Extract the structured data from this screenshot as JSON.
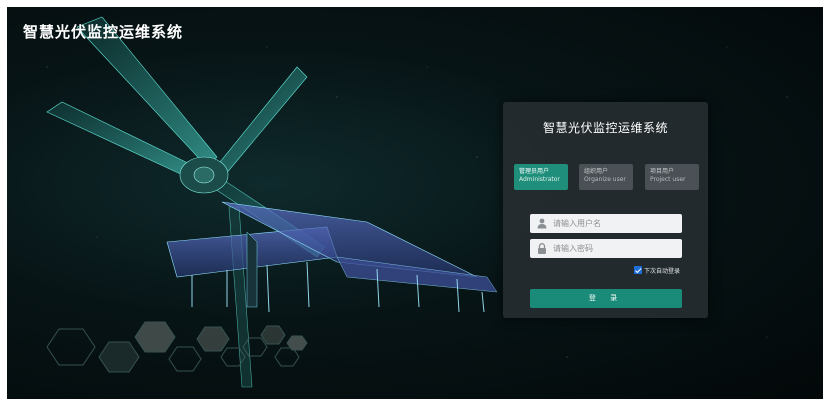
{
  "app": {
    "title": "智慧光伏监控运维系统"
  },
  "login": {
    "panel_title": "智慧光伏监控运维系统",
    "tabs": [
      {
        "label_cn": "管理员用户",
        "label_en": "Administrator",
        "active": true
      },
      {
        "label_cn": "组织用户",
        "label_en": "Organize user",
        "active": false
      },
      {
        "label_cn": "项目用户",
        "label_en": "Project user",
        "active": false
      }
    ],
    "username": {
      "value": "",
      "placeholder": "请输入用户名",
      "icon": "user-icon"
    },
    "password": {
      "value": "",
      "placeholder": "请输入密码",
      "icon": "lock-icon"
    },
    "remember": {
      "label": "下次自动登录",
      "checked": true
    },
    "submit_label": "登 录"
  },
  "colors": {
    "accent": "#1a8b79",
    "active_tab": "#1f8f7c",
    "inactive_tab": "#4a5055",
    "panel_bg": "#262c30",
    "checkbox": "#1e6fd9"
  }
}
